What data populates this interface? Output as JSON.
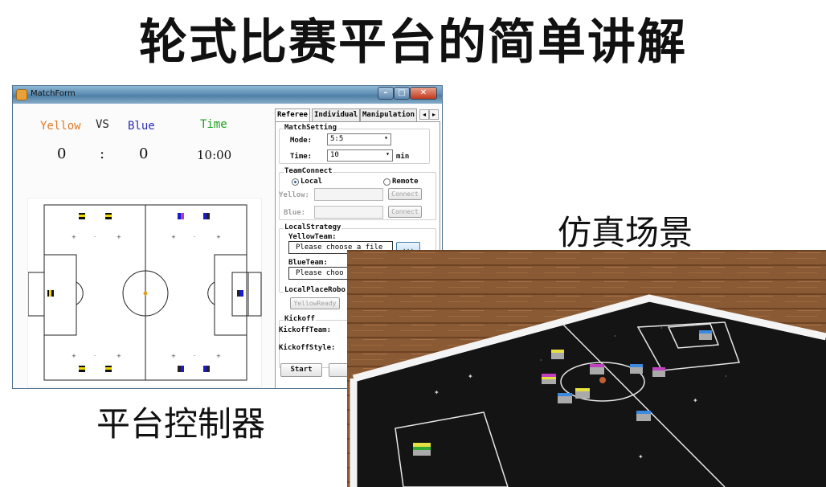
{
  "slide": {
    "title": "轮式比赛平台的简单讲解",
    "caption_simulation": "仿真场景",
    "caption_controller": "平台控制器"
  },
  "window": {
    "title": "MatchForm",
    "buttons": {
      "minimize": "–",
      "maximize": "□",
      "close": "✕"
    }
  },
  "scoreboard": {
    "yellow_label": "Yellow",
    "vs_label": "VS",
    "blue_label": "Blue",
    "time_label": "Time",
    "yellow_score": "0",
    "separator": ":",
    "blue_score": "0",
    "time_value": "10:00",
    "colors": {
      "yellow": "#e07a28",
      "blue": "#2a2ab0",
      "time": "#18a018"
    }
  },
  "tabs": {
    "items": [
      "Referee",
      "Individual",
      "Manipulation"
    ],
    "active": "Referee"
  },
  "referee": {
    "match_setting": {
      "group": "MatchSetting",
      "mode_label": "Mode:",
      "mode_value": "5:5",
      "time_label": "Time:",
      "time_value": "10",
      "time_unit": "min"
    },
    "team_connect": {
      "group": "TeamConnect",
      "local_label": "Local",
      "remote_label": "Remote",
      "selected": "Local",
      "yellow_label": "Yellow:",
      "blue_label": "Blue:",
      "connect_label": "Connect"
    },
    "local_strategy": {
      "group": "LocalStrategy",
      "yellow_team_label": "YellowTeam:",
      "yellow_file_placeholder": "Please choose a file",
      "browse_label": "...",
      "blue_team_label": "BlueTeam:",
      "blue_file_placeholder": "Please choo"
    },
    "local_place": {
      "group": "LocalPlaceRobo",
      "yellow_ready_label": "YellowReady"
    },
    "kickoff": {
      "group": "Kickoff",
      "team_label": "KickoffTeam:",
      "style_label": "KickoffStyle:"
    },
    "start_label": "Start"
  }
}
